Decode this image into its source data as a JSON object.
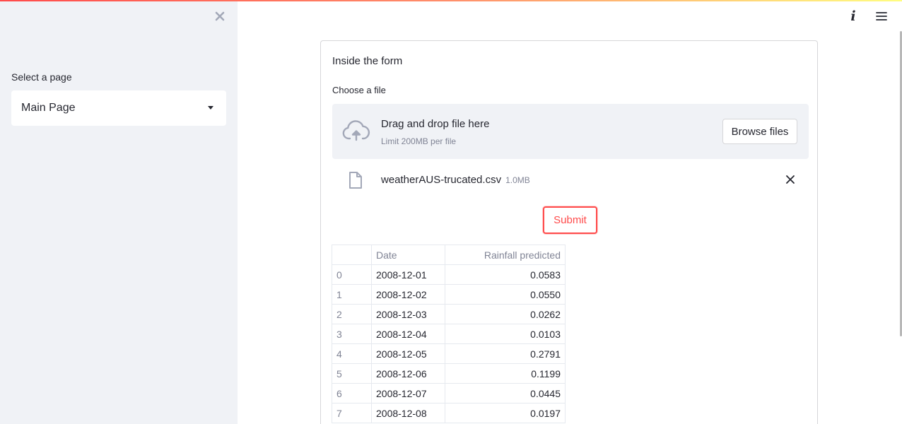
{
  "sidebar": {
    "select_label": "Select a page",
    "selected_page": "Main Page"
  },
  "form": {
    "title": "Inside the form",
    "file_label": "Choose a file",
    "dropzone_main": "Drag and drop file here",
    "dropzone_sub": "Limit 200MB per file",
    "browse_label": "Browse files",
    "uploaded_file": {
      "name": "weatherAUS-trucated.csv",
      "size": "1.0MB"
    },
    "submit_label": "Submit"
  },
  "table": {
    "columns": [
      "",
      "Date",
      "Rainfall predicted"
    ],
    "rows": [
      [
        "0",
        "2008-12-01",
        "0.0583"
      ],
      [
        "1",
        "2008-12-02",
        "0.0550"
      ],
      [
        "2",
        "2008-12-03",
        "0.0262"
      ],
      [
        "3",
        "2008-12-04",
        "0.0103"
      ],
      [
        "4",
        "2008-12-05",
        "0.2791"
      ],
      [
        "5",
        "2008-12-06",
        "0.1199"
      ],
      [
        "6",
        "2008-12-07",
        "0.0445"
      ],
      [
        "7",
        "2008-12-08",
        "0.0197"
      ]
    ]
  },
  "header": {
    "info_icon": "info-icon",
    "menu_icon": "hamburger-menu-icon"
  },
  "colors": {
    "accent": "#ff4b4b",
    "sidebar_bg": "#f0f2f6",
    "text": "#262730",
    "muted": "#808495"
  }
}
